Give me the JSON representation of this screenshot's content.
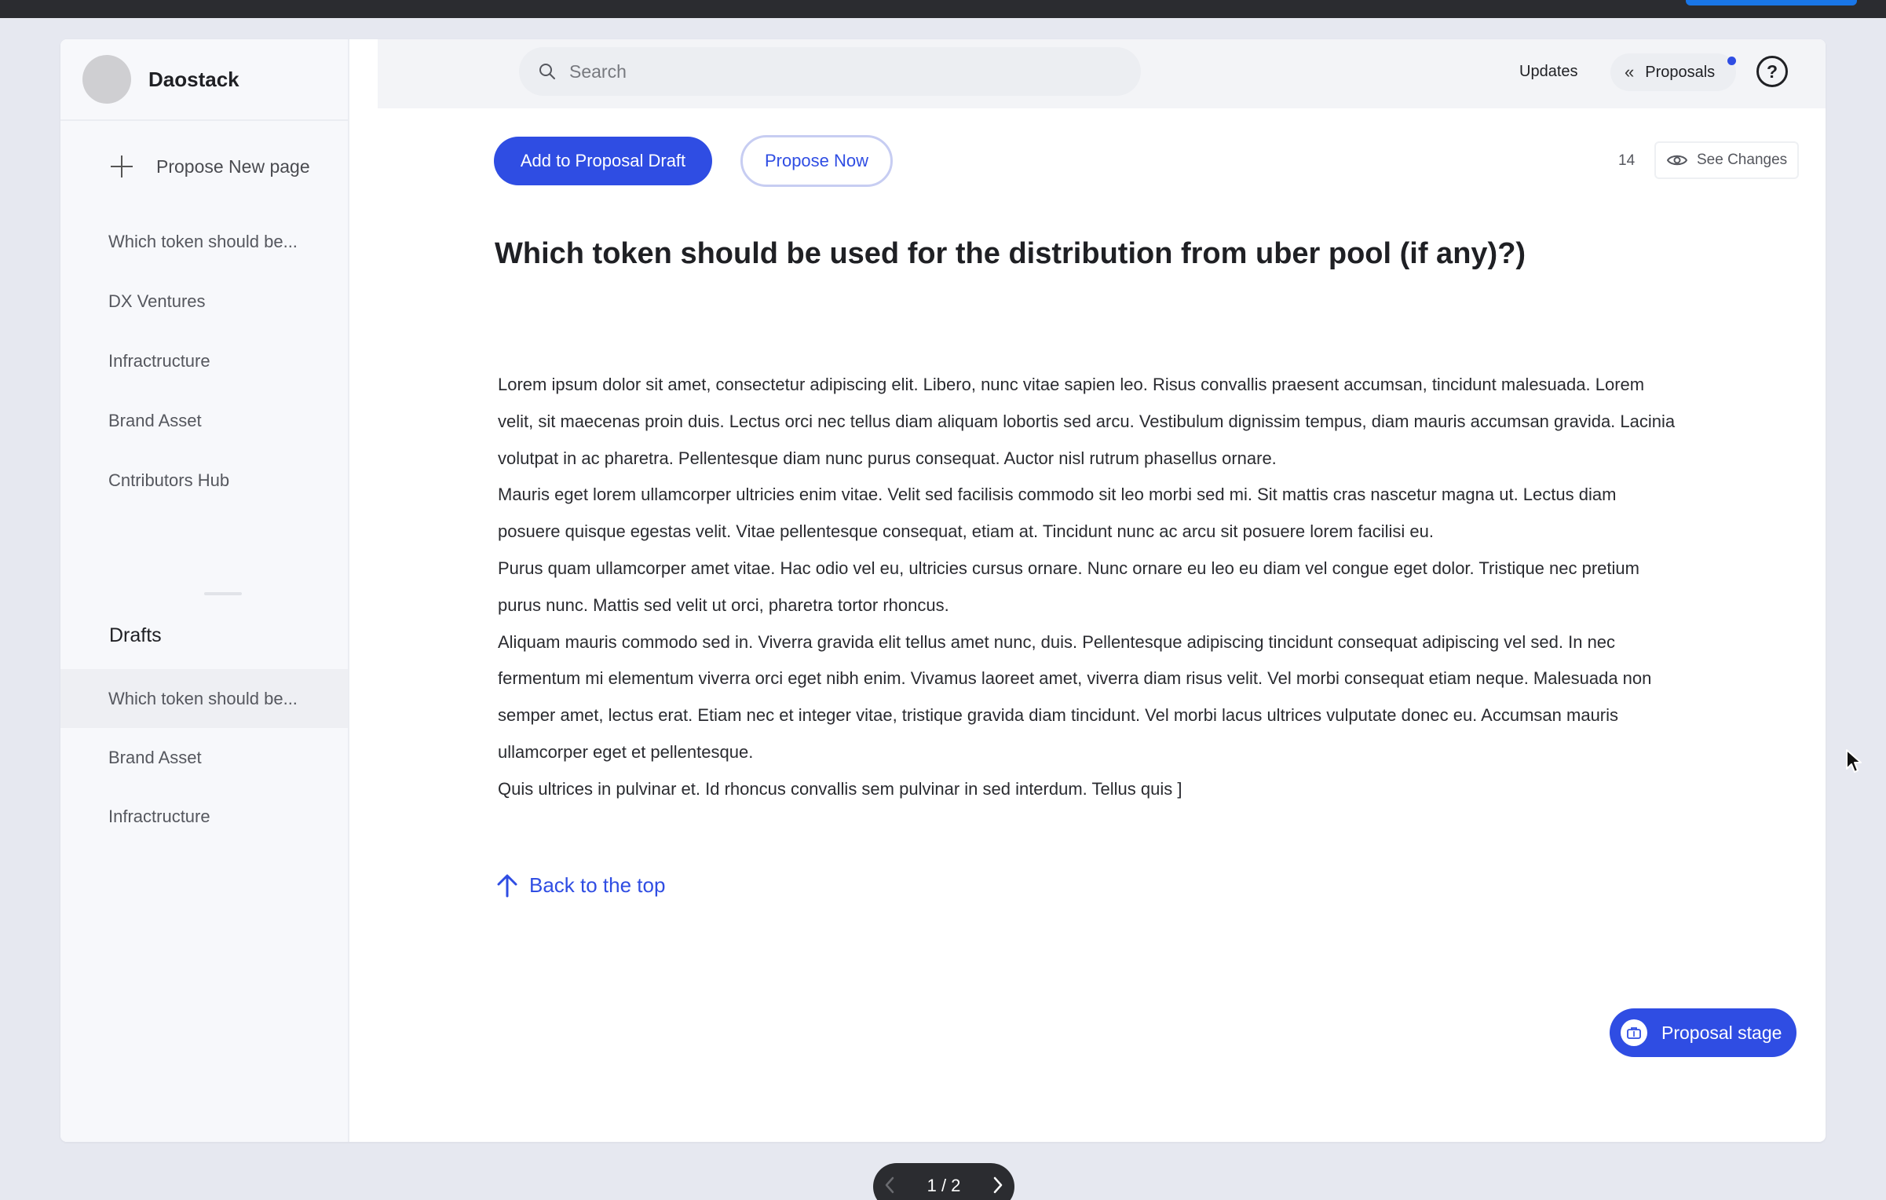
{
  "brand": {
    "name": "Daostack"
  },
  "sidebar": {
    "propose_new": "Propose New page",
    "items": [
      {
        "label": "Which token should be..."
      },
      {
        "label": "DX Ventures"
      },
      {
        "label": "Infractructure"
      },
      {
        "label": "Brand Asset"
      },
      {
        "label": "Cntributors Hub"
      }
    ],
    "drafts_title": "Drafts",
    "drafts": [
      {
        "label": "Which token should be...",
        "active": true
      },
      {
        "label": "Brand Asset"
      },
      {
        "label": "Infractructure"
      }
    ]
  },
  "topbar": {
    "search_placeholder": "Search",
    "updates": "Updates",
    "proposals": "Proposals",
    "help": "?"
  },
  "toolbar": {
    "add_draft": "Add to Proposal Draft",
    "propose_now": "Propose Now",
    "count": "14",
    "see_changes": "See Changes"
  },
  "document": {
    "title": "Which token should be used for the distribution from uber pool (if any)?)",
    "paragraphs": [
      "Lorem ipsum dolor sit amet, consectetur adipiscing elit. Libero, nunc vitae sapien leo. Risus convallis praesent accumsan, tincidunt malesuada. Lorem velit, sit maecenas proin duis. Lectus orci nec tellus diam aliquam lobortis sed arcu. Vestibulum dignissim tempus, diam mauris accumsan gravida. Lacinia volutpat in ac pharetra. Pellentesque diam nunc purus consequat. Auctor nisl rutrum phasellus ornare.",
      "Mauris eget lorem ullamcorper ultricies enim vitae. Velit sed facilisis commodo sit leo morbi sed mi. Sit mattis cras nascetur magna ut. Lectus diam posuere quisque egestas velit. Vitae pellentesque consequat, etiam at. Tincidunt nunc ac arcu sit posuere lorem facilisi eu.",
      "Purus quam ullamcorper amet vitae. Hac odio vel eu, ultricies cursus ornare. Nunc ornare eu leo eu diam vel congue eget dolor. Tristique nec pretium purus nunc. Mattis sed velit ut orci, pharetra tortor rhoncus.",
      "Aliquam mauris commodo sed in. Viverra gravida elit tellus amet nunc, duis. Pellentesque adipiscing tincidunt consequat adipiscing vel sed. In nec fermentum mi elementum viverra orci eget nibh enim. Vivamus laoreet amet, viverra diam risus velit. Vel morbi consequat etiam neque. Malesuada non semper amet, lectus erat. Etiam nec et integer vitae, tristique gravida diam tincidunt. Vel morbi lacus ultrices vulputate donec eu. Accumsan mauris ullamcorper eget et pellentesque.",
      "Quis ultrices in pulvinar et. Id rhoncus convallis sem pulvinar in sed interdum. Tellus quis ]"
    ],
    "back_to_top": "Back to the top"
  },
  "stage_button": "Proposal stage",
  "pager": {
    "text": "1 / 2"
  },
  "colors": {
    "accent": "#2f4de3",
    "sidebar_bg": "#f7f8fb",
    "page_bg": "#e6e8f0"
  }
}
